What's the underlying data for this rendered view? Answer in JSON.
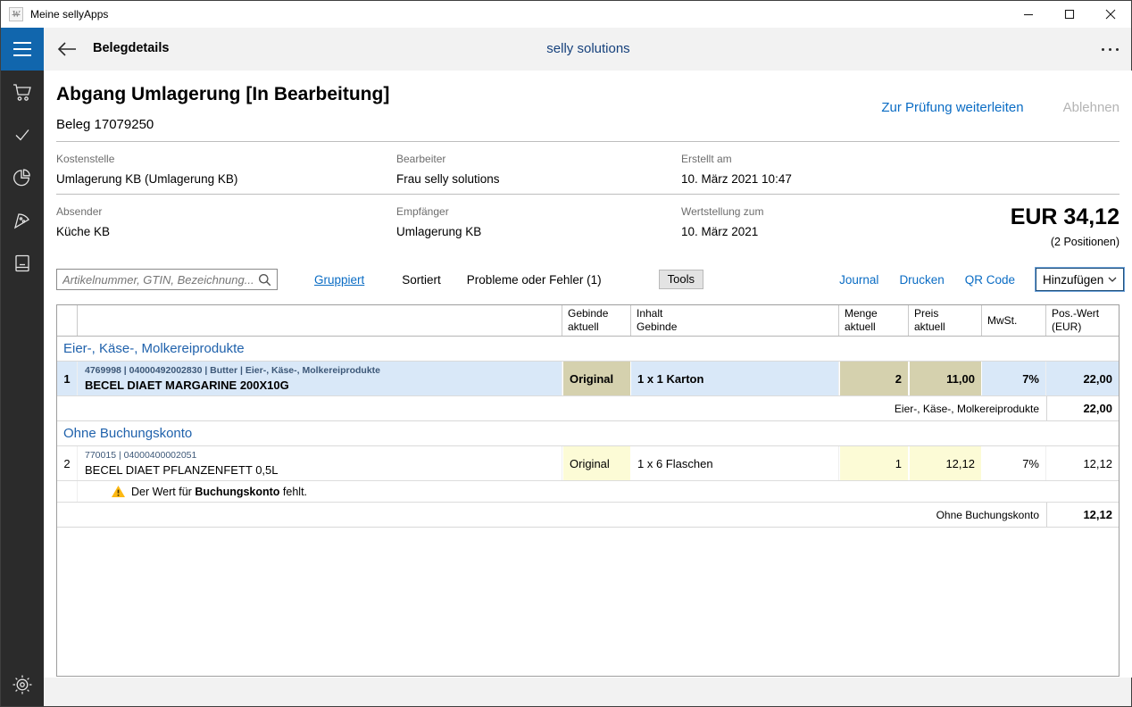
{
  "colors": {
    "accent_link": "#0a6cc4",
    "hamburger_bg": "#1166ad",
    "sidebar_bg": "#2b2b2b",
    "appbar_bg": "#f2f2f2",
    "selected_row": "#d9e8f8",
    "cell_highlight": "#fcfbd6",
    "cell_highlight_selected": "#d5d1ae",
    "group_title": "#2062ac",
    "warning_yellow": "#fdb913"
  },
  "window": {
    "logo": "W",
    "title": "Meine sellyApps"
  },
  "appbar": {
    "page_title": "Belegdetails",
    "center_title": "selly solutions"
  },
  "sidebar": {
    "items": [
      {
        "icon": "cart-icon"
      },
      {
        "icon": "check-icon"
      },
      {
        "icon": "pie-chart-icon"
      },
      {
        "icon": "pizza-icon"
      },
      {
        "icon": "book-icon"
      }
    ],
    "bottom_icon": "gear-icon"
  },
  "doc": {
    "title": "Abgang Umlagerung [In Bearbeitung]",
    "subtitle": "Beleg 17079250",
    "actions": {
      "forward": "Zur Prüfung weiterleiten",
      "reject": "Ablehnen"
    },
    "fields": [
      {
        "label": "Kostenstelle",
        "value": "Umlagerung KB (Umlagerung KB)"
      },
      {
        "label": "Bearbeiter",
        "value": "Frau selly solutions"
      },
      {
        "label": "Erstellt am",
        "value": "10. März 2021 10:47"
      },
      {
        "label": "Absender",
        "value": "Küche KB"
      },
      {
        "label": "Empfänger",
        "value": "Umlagerung KB"
      },
      {
        "label": "Wertstellung zum",
        "value": "10. März 2021"
      }
    ],
    "total": {
      "amount": "EUR 34,12",
      "positions": "(2 Positionen)"
    }
  },
  "toolbar": {
    "search_placeholder": "Artikelnummer, GTIN, Bezeichnung...",
    "grouped": "Gruppiert",
    "sorted": "Sortiert",
    "problems": "Probleme oder Fehler (1)",
    "tools": "Tools",
    "journal": "Journal",
    "print": "Drucken",
    "qr": "QR Code",
    "add": "Hinzufügen"
  },
  "table": {
    "headers": {
      "gebinde": "Gebinde\naktuell",
      "inhalt": "Inhalt\nGebinde",
      "menge": "Menge\naktuell",
      "preis": "Preis\naktuell",
      "mwst": "MwSt.",
      "poswert": "Pos.-Wert\n(EUR)"
    },
    "groups": [
      {
        "name": "Eier-, Käse-, Molkereiprodukte",
        "row": {
          "num": "1",
          "meta": "4769998 | 04000492002830 | Butter | Eier-, Käse-, Molkereiprodukte",
          "name": "BECEL DIAET MARGARINE 200X10G",
          "gebinde": "Original",
          "inhalt": "1 x 1 Karton",
          "menge": "2",
          "preis": "11,00",
          "mwst": "7%",
          "wert": "22,00"
        },
        "subtotal": {
          "label": "Eier-, Käse-, Molkereiprodukte",
          "value": "22,00"
        }
      },
      {
        "name": "Ohne Buchungskonto",
        "row": {
          "num": "2",
          "meta": "770015 | 04000400002051",
          "name": "BECEL DIAET PFLANZENFETT 0,5L",
          "gebinde": "Original",
          "inhalt": "1 x 6 Flaschen",
          "menge": "1",
          "preis": "12,12",
          "mwst": "7%",
          "wert": "12,12"
        },
        "warning": {
          "prefix": "Der Wert für ",
          "bold": "Buchungskonto",
          "suffix": " fehlt."
        },
        "subtotal": {
          "label": "Ohne Buchungskonto",
          "value": "12,12"
        }
      }
    ]
  }
}
